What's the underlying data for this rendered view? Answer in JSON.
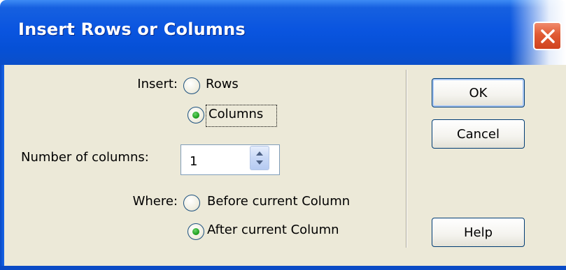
{
  "dialog": {
    "title": "Insert Rows or Columns",
    "close_icon": "close-x-icon"
  },
  "insert": {
    "label": "Insert:",
    "options": [
      {
        "label": "Rows",
        "checked": false
      },
      {
        "label": "Columns",
        "checked": true
      }
    ]
  },
  "number": {
    "label": "Number of columns:",
    "value": "1"
  },
  "where": {
    "label": "Where:",
    "options": [
      {
        "label": "Before current Column",
        "checked": false
      },
      {
        "label": "After current Column",
        "checked": true
      }
    ]
  },
  "buttons": {
    "ok": "OK",
    "cancel": "Cancel",
    "help": "Help"
  },
  "colors": {
    "titlebar": "#0a55e0",
    "client_bg": "#ece9d8",
    "close_button": "#e05a33",
    "radio_checked": "#21a121"
  }
}
